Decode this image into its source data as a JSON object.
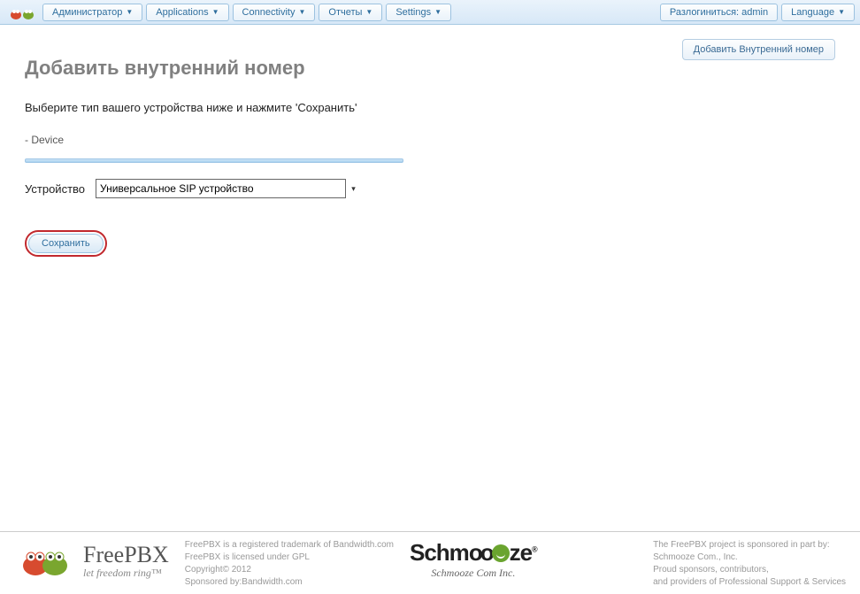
{
  "topmenu": {
    "admin": "Администратор",
    "applications": "Applications",
    "connectivity": "Connectivity",
    "reports": "Отчеты",
    "settings": "Settings",
    "logout": "Разлогиниться: admin",
    "language": "Language"
  },
  "side": {
    "add_extension": "Добавить Внутренний номер"
  },
  "page": {
    "title": "Добавить внутренний номер",
    "instruction": "Выберите тип вашего устройства ниже и нажмите 'Сохранить'",
    "section": "- Device"
  },
  "form": {
    "device_label": "Устройство",
    "device_selected": "Универсальное SIP устройство",
    "save": "Сохранить"
  },
  "footer": {
    "freepbx_name": "FreePBX",
    "freepbx_tag": "let freedom ring™",
    "line1": "FreePBX is a registered trademark of Bandwidth.com",
    "line2": "FreePBX is licensed under GPL",
    "line3": "Copyright© 2012",
    "line4": "Sponsored by:Bandwidth.com",
    "schmooze_main": "Schm",
    "schmooze_main2": "ze",
    "schmooze_sub": "Schmooze Com Inc.",
    "right1": "The FreePBX project is sponsored in part by:",
    "right2": "Schmooze Com., Inc.",
    "right3": "Proud sponsors, contributors,",
    "right4": "and providers of Professional Support & Services"
  }
}
